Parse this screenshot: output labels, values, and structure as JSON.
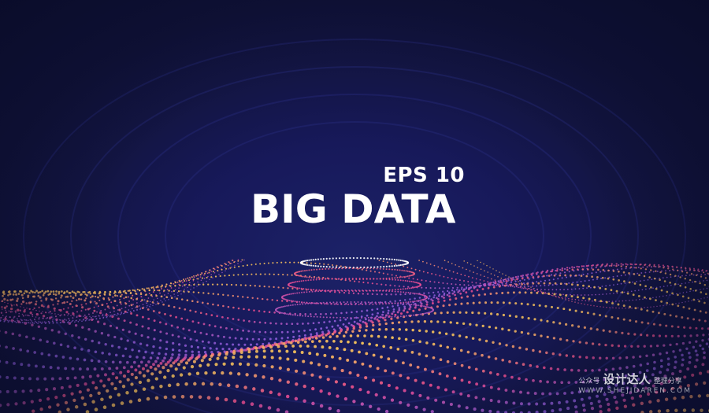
{
  "title": {
    "eps_label": "EPS 10",
    "main_label": "BIG DATA"
  },
  "watermark": {
    "prefix": "公众号",
    "brand": "设计达人",
    "suffix": "整理分享",
    "url": "WWW.SHEJIDAREN.COM"
  },
  "colors": {
    "background": "#141a4a",
    "text": "#ffffff",
    "particle_warm": "#f7c35a",
    "particle_pink": "#e64a8c",
    "particle_violet": "#8a5bd8"
  }
}
